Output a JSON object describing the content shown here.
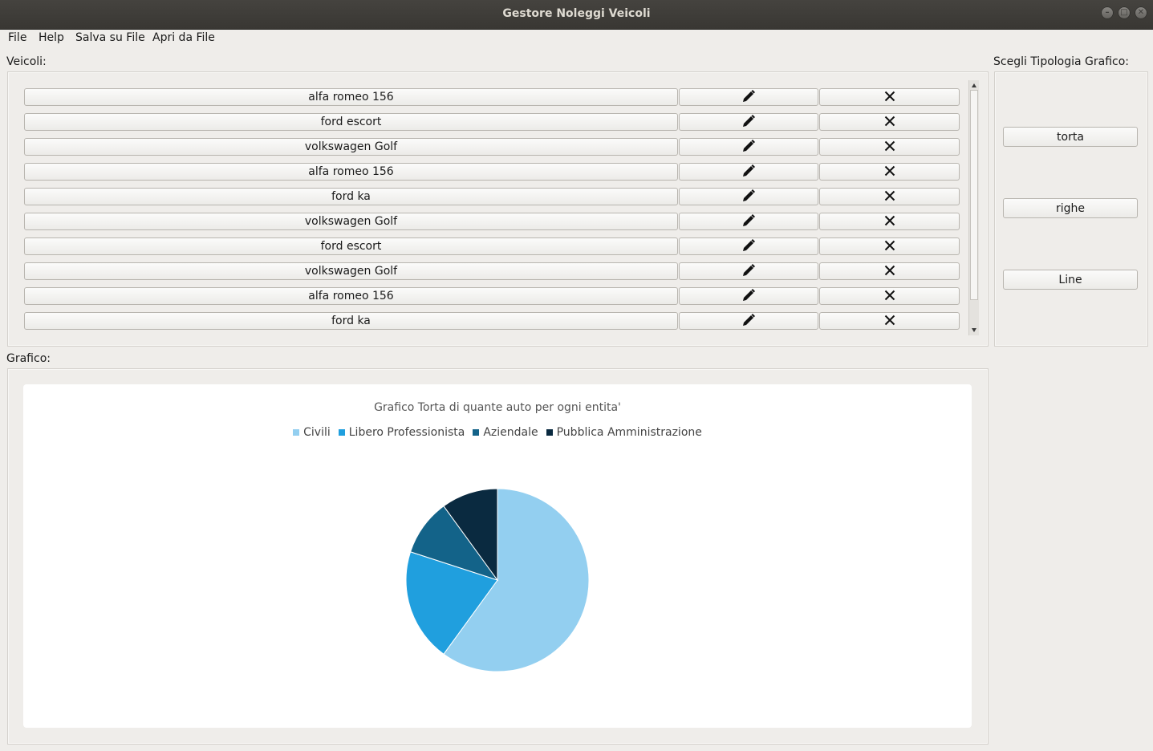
{
  "window": {
    "title": "Gestore Noleggi Veicoli"
  },
  "menu": [
    "File",
    "Help",
    "Salva su File",
    "Apri da File"
  ],
  "veicoli": {
    "label": "Veicoli:",
    "rows": [
      "alfa romeo 156",
      "ford escort",
      "volkswagen Golf",
      "alfa romeo 156",
      "ford ka",
      "volkswagen Golf",
      "ford escort",
      "volkswagen Golf",
      "alfa romeo 156",
      "ford ka"
    ],
    "edit_icon": "pencil-icon",
    "delete_icon": "x-icon"
  },
  "sidebar": {
    "label": "Scegli Tipologia Grafico:",
    "buttons": [
      "torta",
      "righe",
      "Line"
    ]
  },
  "grafico": {
    "label": "Grafico:"
  },
  "chart_data": {
    "type": "pie",
    "title": "Grafico Torta di quante auto per ogni entita'",
    "legend_position": "top",
    "slices": [
      {
        "name": "Civili",
        "value": 6,
        "color": "#93cff0"
      },
      {
        "name": "Libero Professionista",
        "value": 2,
        "color": "#209fde"
      },
      {
        "name": "Aziendale",
        "value": 1,
        "color": "#136389"
      },
      {
        "name": "Pubblica Amministrazione",
        "value": 1,
        "color": "#0a2a40"
      }
    ]
  }
}
